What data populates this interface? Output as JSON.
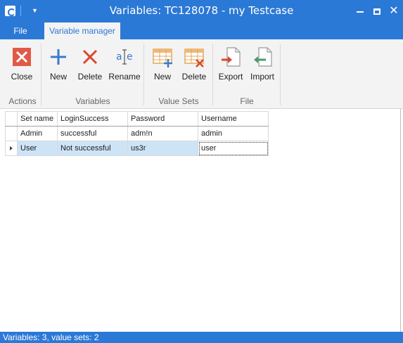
{
  "window": {
    "title": "Variables: TC128078 - my Testcase",
    "minimize": "—",
    "close": "✕"
  },
  "tabs": [
    {
      "label": "File",
      "active": false
    },
    {
      "label": "Variable manager",
      "active": true
    }
  ],
  "ribbon": {
    "groups": [
      {
        "label": "Actions",
        "buttons": [
          {
            "label": "Close",
            "icon": "close-icon"
          }
        ]
      },
      {
        "label": "Variables",
        "buttons": [
          {
            "label": "New",
            "icon": "plus-icon"
          },
          {
            "label": "Delete",
            "icon": "x-icon"
          },
          {
            "label": "Rename",
            "icon": "rename-icon"
          }
        ]
      },
      {
        "label": "Value Sets",
        "buttons": [
          {
            "label": "New",
            "icon": "table-add-icon"
          },
          {
            "label": "Delete",
            "icon": "table-delete-icon"
          }
        ]
      },
      {
        "label": "File",
        "buttons": [
          {
            "label": "Export",
            "icon": "export-icon"
          },
          {
            "label": "Import",
            "icon": "import-icon"
          }
        ]
      }
    ]
  },
  "grid": {
    "columns": [
      "Set name",
      "LoginSuccess",
      "Password",
      "Username"
    ],
    "rows": [
      [
        "Admin",
        "successful",
        "adm!n",
        "admin"
      ],
      [
        "User",
        "Not successful",
        "us3r",
        "user"
      ]
    ],
    "selected_row": 1
  },
  "status": "Variables: 3, value sets: 2",
  "colors": {
    "accent": "#2b79d6",
    "ribbon_bg": "#f3f3f3",
    "selection": "#cde4f7",
    "close_red": "#e05a47"
  }
}
